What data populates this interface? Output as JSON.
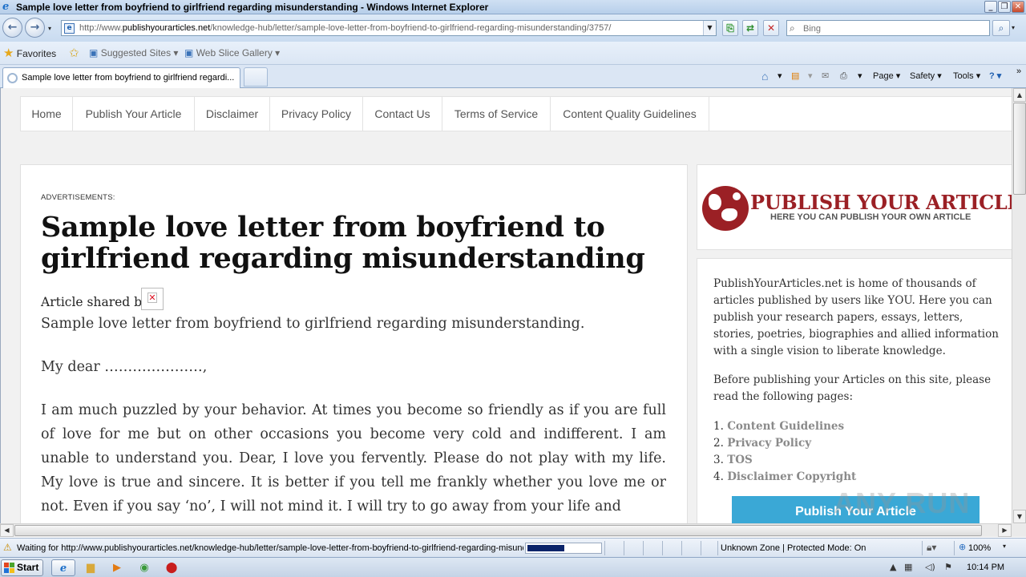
{
  "window": {
    "title": "Sample love letter from boyfriend to girlfriend regarding misunderstanding - Windows Internet Explorer",
    "minimize": "_",
    "restore": "❐",
    "close": "✕"
  },
  "address": {
    "url_prefix": "http://www.",
    "url_domain": "publishyourarticles.net",
    "url_path": "/knowledge-hub/letter/sample-love-letter-from-boyfriend-to-girlfriend-regarding-misunderstanding/3757/",
    "search_placeholder": "Bing"
  },
  "favorites_bar": {
    "favorites": "Favorites",
    "suggested_sites": "Suggested Sites ▾",
    "web_slice_gallery": "Web Slice Gallery ▾"
  },
  "tabs": [
    {
      "label": "Sample love letter from boyfriend to girlfriend regardi..."
    }
  ],
  "command_bar": {
    "page": "Page ▾",
    "safety": "Safety ▾",
    "tools": "Tools ▾",
    "help": "? ▾"
  },
  "site_nav": [
    {
      "label": "Home"
    },
    {
      "label": "Publish Your Article"
    },
    {
      "label": "Disclaimer"
    },
    {
      "label": "Privacy Policy"
    },
    {
      "label": "Contact Us"
    },
    {
      "label": "Terms of Service"
    },
    {
      "label": "Content Quality Guidelines"
    }
  ],
  "article": {
    "ads_label": "ADVERTISEMENTS:",
    "title": "Sample love letter from boyfriend to girlfriend regarding misunderstanding",
    "shared_by": "Article shared by",
    "intro": "Sample love letter from boyfriend to girlfriend regarding misunderstanding.",
    "greeting": "My dear …………………,",
    "body": "I am much puzzled by your behavior. At times you become so friendly as if you are full of love for me but on other occasions you become very cold and indifferent. I am unable to understand you. Dear, I love you fervently. Please do not play with my life. My love is true and sincere. It is better if you tell me frankly whether you love me or not. Even if you say ‘no’, I will not mind it. I will try to go away from your life and"
  },
  "sidebar": {
    "logo_title": "PUBLISH YOUR ARTICLE",
    "logo_tagline": "HERE YOU CAN PUBLISH YOUR OWN ARTICLE",
    "about": "PublishYourArticles.net is home of thousands of articles published by users like YOU. Here you can publish your research papers, essays, letters, stories, poetries, biographies and allied information with a single vision to liberate knowledge.",
    "before": "Before publishing your Articles on this site, please read the following pages:",
    "links": [
      {
        "num": "1.",
        "label": "Content Guidelines"
      },
      {
        "num": "2.",
        "label": "Privacy Policy"
      },
      {
        "num": "3.",
        "label": "TOS"
      },
      {
        "num": "4.",
        "label": "Disclaimer Copyright"
      }
    ],
    "publish_button": "Publish Your Article"
  },
  "status_bar": {
    "text": "Waiting for http://www.publishyourarticles.net/knowledge-hub/letter/sample-love-letter-from-boyfriend-to-girlfriend-regarding-misunderstanding/3757/",
    "progress": 0.5,
    "zone": "Unknown Zone | Protected Mode: On",
    "zoom": "100%"
  },
  "taskbar": {
    "start": "Start",
    "clock": "10:14 PM"
  },
  "watermark": "ANY RUN",
  "colors": {
    "brand_red": "#9b2025",
    "publish_button": "#3aa8d6",
    "progress_fill": "#0a246a"
  }
}
